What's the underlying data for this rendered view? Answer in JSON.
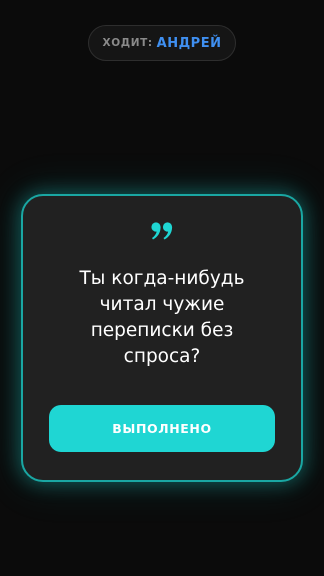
{
  "header": {
    "turn_label": "ХОДИТ:",
    "player_name": "АНДРЕЙ"
  },
  "card": {
    "icon": "quote-icon",
    "question": "Ты когда-нибудь читал чужие переписки без спроса?",
    "done_label": "ВЫПОЛНЕНО"
  },
  "colors": {
    "background": "#0b0b0b",
    "card_background": "#212121",
    "accent": "#1fd6d3",
    "player_name": "#3f8ff0"
  }
}
